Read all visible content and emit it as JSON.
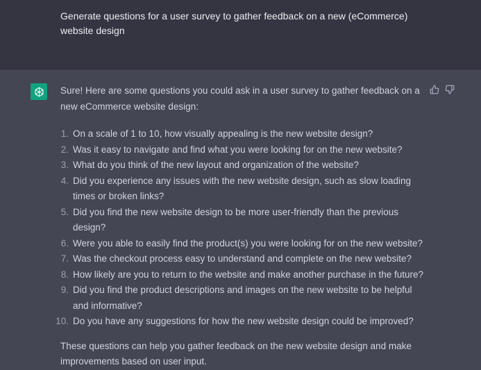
{
  "user_message": {
    "text": "Generate questions for a user survey to gather feedback on a new (eCommerce) website design"
  },
  "assistant_message": {
    "avatar_icon": "chatgpt-logo-icon",
    "avatar_color": "#10a37f",
    "intro": "Sure! Here are some questions you could ask in a user survey to gather feedback on a new eCommerce website design:",
    "items": [
      {
        "num": "1.",
        "text": "On a scale of 1 to 10, how visually appealing is the new website design?"
      },
      {
        "num": "2.",
        "text": "Was it easy to navigate and find what you were looking for on the new website?"
      },
      {
        "num": "3.",
        "text": "What do you think of the new layout and organization of the website?"
      },
      {
        "num": "4.",
        "text": "Did you experience any issues with the new website design, such as slow loading times or broken links?"
      },
      {
        "num": "5.",
        "text": "Did you find the new website design to be more user-friendly than the previous design?"
      },
      {
        "num": "6.",
        "text": "Were you able to easily find the product(s) you were looking for on the new website?"
      },
      {
        "num": "7.",
        "text": "Was the checkout process easy to understand and complete on the new website?"
      },
      {
        "num": "8.",
        "text": "How likely are you to return to the website and make another purchase in the future?"
      },
      {
        "num": "9.",
        "text": "Did you find the product descriptions and images on the new website to be helpful and informative?"
      },
      {
        "num": "10.",
        "text": "Do you have any suggestions for how the new website design could be improved?"
      }
    ],
    "outro": "These questions can help you gather feedback on the new website design and make improvements based on user input."
  },
  "feedback": {
    "thumbs_up_icon": "thumbs-up-icon",
    "thumbs_down_icon": "thumbs-down-icon"
  },
  "colors": {
    "user_bg": "#343541",
    "assistant_bg": "#444654",
    "text": "#d1d5db"
  }
}
